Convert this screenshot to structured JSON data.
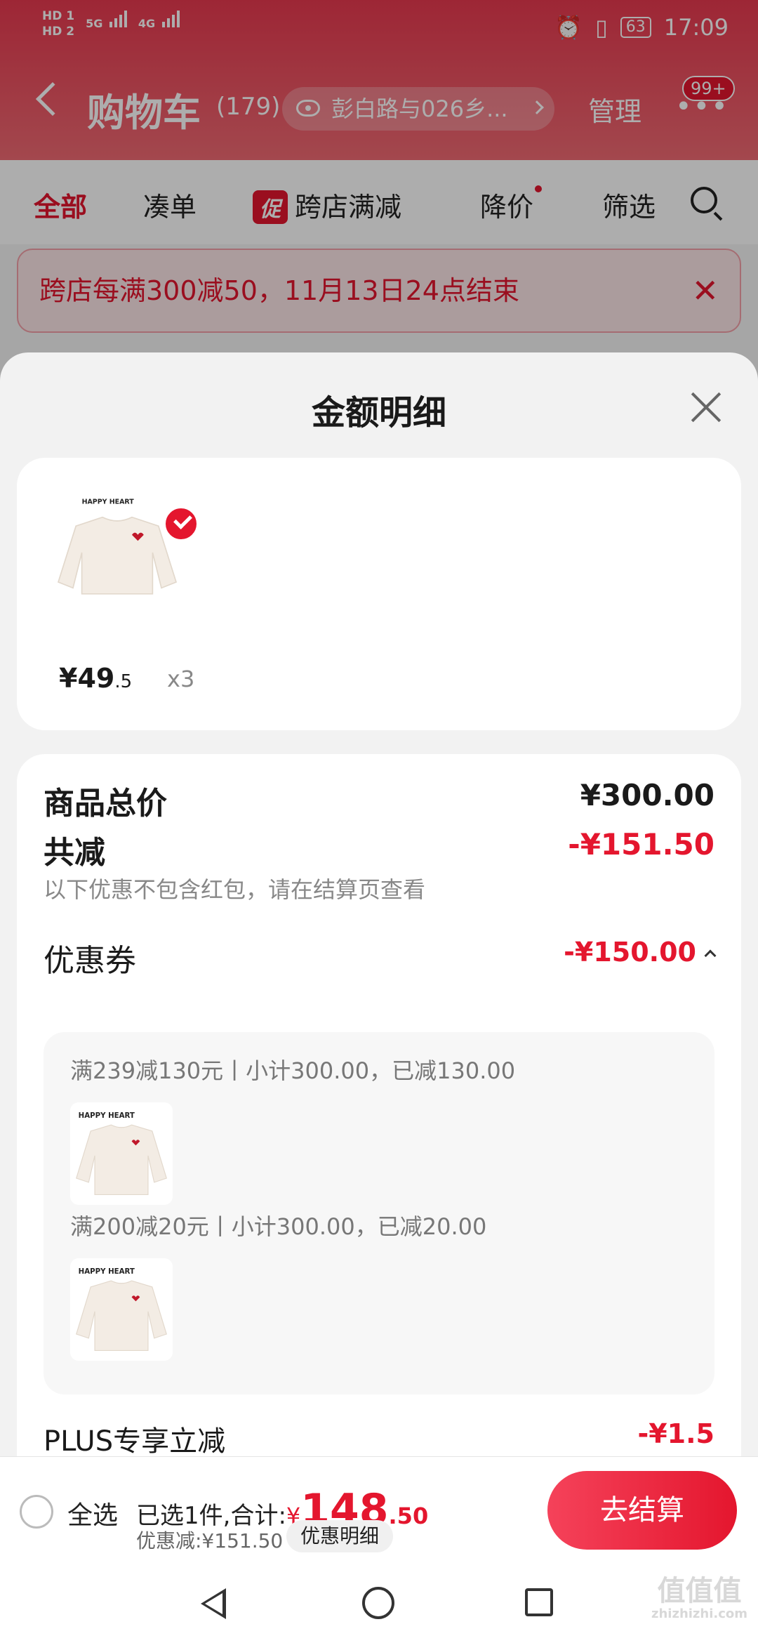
{
  "status_bar": {
    "hd1": "HD 1",
    "hd2": "HD 2",
    "sig1": "5G",
    "sig2": "4G",
    "battery": "63",
    "time": "17:09"
  },
  "header": {
    "title": "购物车",
    "count": "(179)",
    "address": "彭白路与026乡...",
    "manage": "管理",
    "more_badge": "99+"
  },
  "tabs": [
    {
      "label": "全部",
      "active": true
    },
    {
      "label": "凑单"
    },
    {
      "label": "跨店满减",
      "tag": "促"
    },
    {
      "label": "降价"
    },
    {
      "label": "筛选"
    }
  ],
  "promo_banner": {
    "text": "跨店每满300减50，11月13日24点结束"
  },
  "sheet": {
    "title": "金额明细",
    "item": {
      "price_main": "¥49",
      "price_decimal": ".5",
      "qty": "x3"
    },
    "total_label": "商品总价",
    "total_value": "¥300.00",
    "reduction_label": "共减",
    "reduction_value": "-¥151.50",
    "reduction_note": "以下优惠不包含红包，请在结算页查看",
    "coupon_label": "优惠券",
    "coupon_value": "-¥150.00",
    "coupons": [
      {
        "text": "满239减130元丨小计300.00，已减130.00"
      },
      {
        "text": "满200减20元丨小计300.00，已减20.00"
      }
    ],
    "plus_label": "PLUS专享立减",
    "plus_value": "-¥1.5"
  },
  "bottom_bar": {
    "select_all": "全选",
    "summary_prefix": "已选1件,合计:",
    "currency": "¥",
    "total_main": "148",
    "total_decimal": ".50",
    "discount": "优惠减:¥151.50",
    "detail_chip": "优惠明细",
    "checkout": "去结算"
  },
  "watermark": {
    "main": "值值值",
    "sub": "zhizhizhi.com"
  },
  "colors": {
    "accent": "#e4162e",
    "header_top": "#e8394f"
  }
}
